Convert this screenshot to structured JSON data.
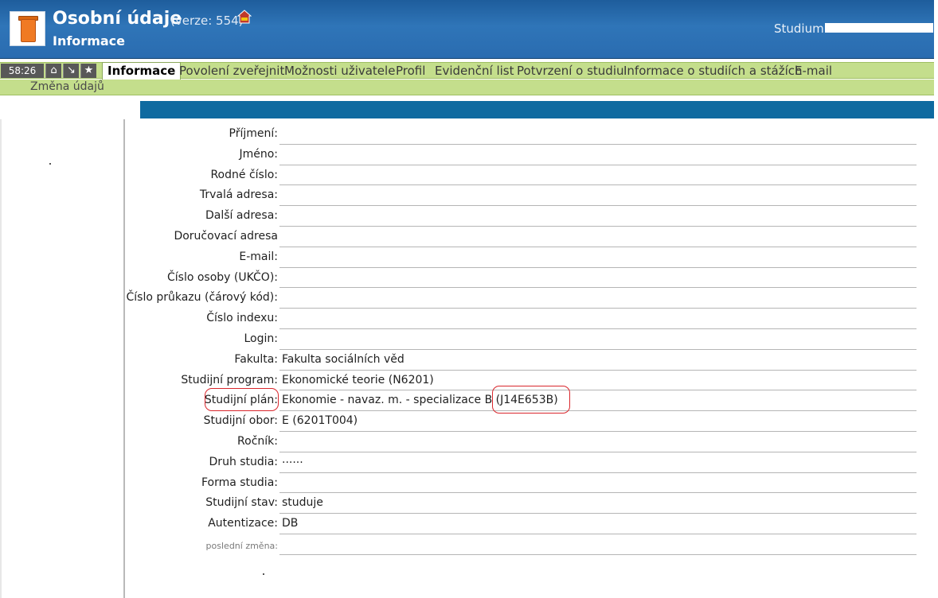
{
  "header": {
    "title": "Osobní údaje",
    "version": "(verze: 554)",
    "subtitle": "Informace",
    "studium_label": "Studium:",
    "app_icon": "jar-icon",
    "home_icon": "home-icon"
  },
  "menubar": {
    "timer": "58:26",
    "buttons": [
      {
        "icon": "home-icon",
        "glyph": "⌂"
      },
      {
        "icon": "arrow-down-right-icon",
        "glyph": "↘"
      },
      {
        "icon": "star-icon",
        "glyph": "★"
      }
    ],
    "tabs": [
      {
        "label": "Informace",
        "active": true
      },
      {
        "label": "Povolení zveřejnit"
      },
      {
        "label": "Možnosti uživatele"
      },
      {
        "label": "Profil"
      },
      {
        "label": "Evidenční list"
      },
      {
        "label": "Potvrzení o studiu"
      },
      {
        "label": "Informace o studiích a stážích"
      },
      {
        "label": "E-mail"
      }
    ],
    "submenu": "Změna údajů"
  },
  "form": {
    "rows": [
      {
        "label": "Příjmení:",
        "value": ""
      },
      {
        "label": "Jméno:",
        "value": ""
      },
      {
        "label": "Rodné číslo:",
        "value": ""
      },
      {
        "label": "Trvalá adresa:",
        "value": ""
      },
      {
        "label": "Další adresa:",
        "value": ""
      },
      {
        "label": "Doručovací adresa",
        "value": ""
      },
      {
        "label": "E-mail:",
        "value": ""
      },
      {
        "label": "Číslo osoby (UKČO):",
        "value": ""
      },
      {
        "label": "Číslo průkazu (čárový kód):",
        "value": ""
      },
      {
        "label": "Číslo indexu:",
        "value": ""
      },
      {
        "label": "Login:",
        "value": ""
      },
      {
        "label": "Fakulta:",
        "value": "Fakulta sociálních věd"
      },
      {
        "label": "Studijní program:",
        "value": "Ekonomické teorie (N6201)"
      },
      {
        "label": "Studijní plán:",
        "value": "Ekonomie - navaz. m. - specializace B (J14E653B)"
      },
      {
        "label": "Studijní obor:",
        "value": "E (6201T004)"
      },
      {
        "label": "Ročník:",
        "value": ""
      },
      {
        "label": "Druh studia:",
        "value": "......"
      },
      {
        "label": "Forma studia:",
        "value": ""
      },
      {
        "label": "Studijní stav:",
        "value": "studuje"
      },
      {
        "label": "Autentizace:",
        "value": "DB"
      },
      {
        "label": "poslední změna:",
        "value": "",
        "small": true
      }
    ]
  },
  "colors": {
    "header_blue": "#2a6cb0",
    "menu_green": "#c4de8c",
    "band_blue": "#0f6aa0",
    "highlight_red": "#d9262c"
  }
}
